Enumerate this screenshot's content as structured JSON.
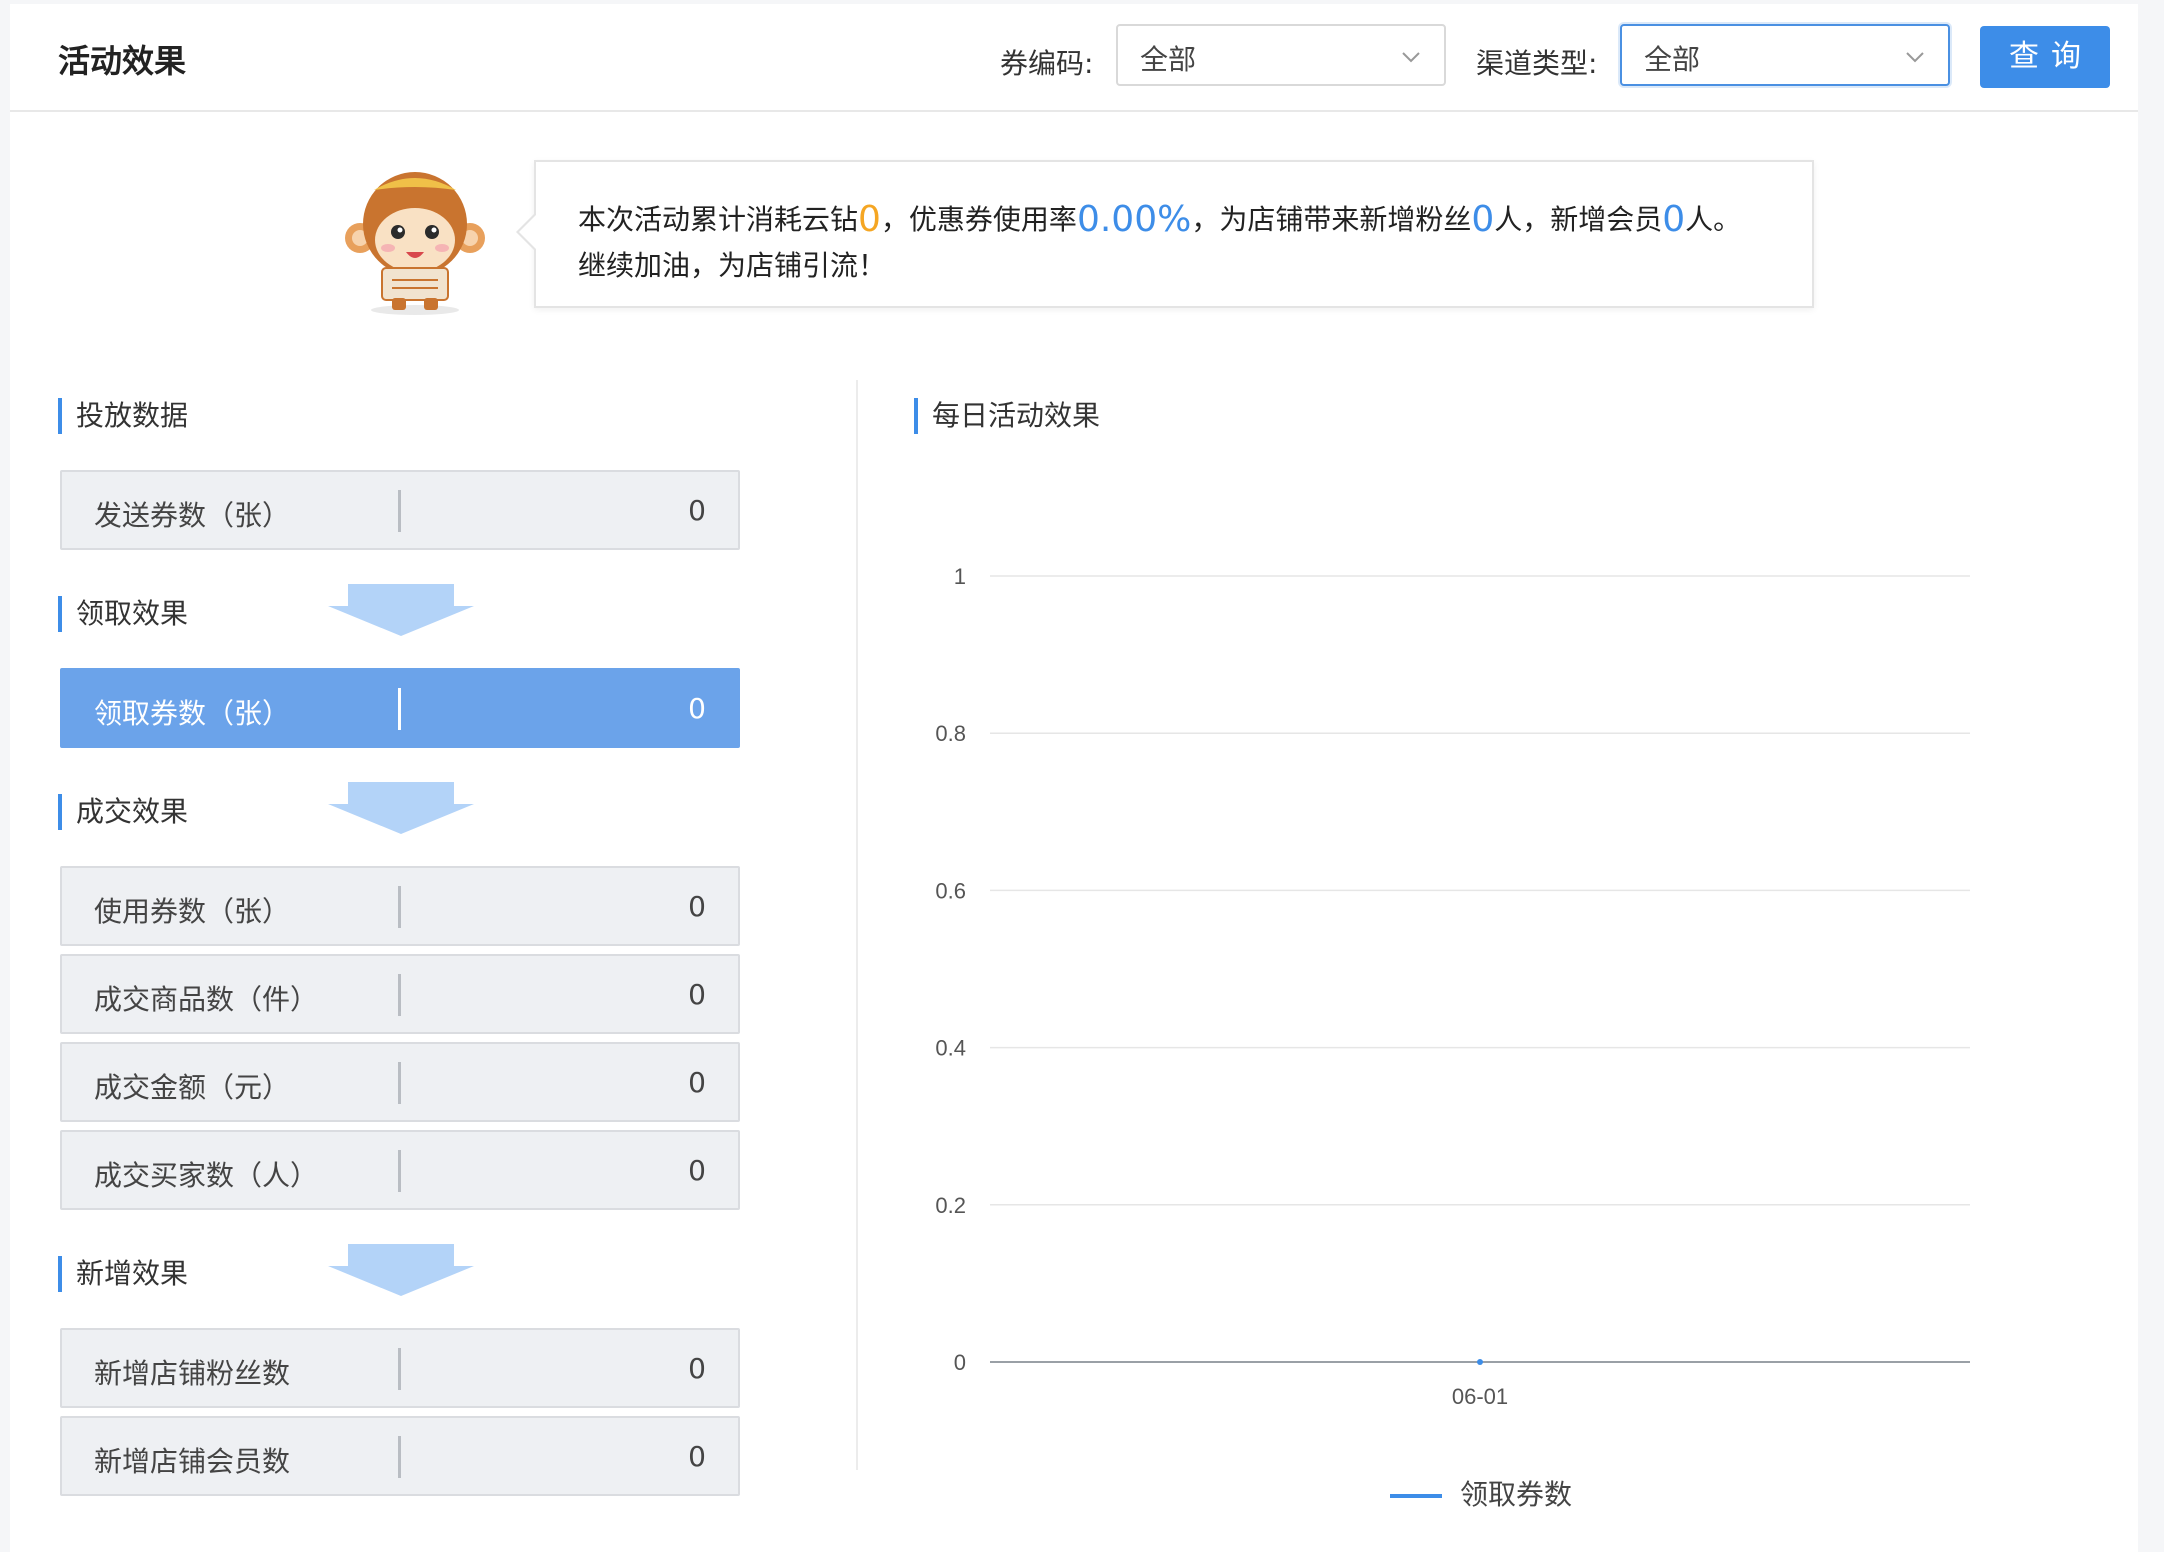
{
  "header": {
    "title": "活动效果",
    "coupon_code_label": "券编码:",
    "coupon_code_value": "全部",
    "channel_type_label": "渠道类型:",
    "channel_type_value": "全部",
    "query_button": "查询"
  },
  "summary": {
    "text_1": "本次活动累计消耗云钻",
    "cloud_diamonds": "0",
    "text_2": "，优惠券使用率",
    "usage_rate": "0.00%",
    "text_3": "，为店铺带来新增粉丝",
    "new_fans": "0",
    "text_4": "人，新增会员",
    "new_members": "0",
    "text_5": "人。",
    "line_2": "继续加油，为店铺引流！"
  },
  "sections": {
    "delivery": {
      "title": "投放数据",
      "items": [
        {
          "label": "发送券数（张）",
          "value": "0"
        }
      ]
    },
    "receive": {
      "title": "领取效果",
      "items": [
        {
          "label": "领取券数（张）",
          "value": "0"
        }
      ]
    },
    "deal": {
      "title": "成交效果",
      "items": [
        {
          "label": "使用券数（张）",
          "value": "0"
        },
        {
          "label": "成交商品数（件）",
          "value": "0"
        },
        {
          "label": "成交金额（元）",
          "value": "0"
        },
        {
          "label": "成交买家数（人）",
          "value": "0"
        }
      ]
    },
    "growth": {
      "title": "新增效果",
      "items": [
        {
          "label": "新增店铺粉丝数",
          "value": "0"
        },
        {
          "label": "新增店铺会员数",
          "value": "0"
        }
      ]
    }
  },
  "colors": {
    "accent": "#3d8de8",
    "highlight": "#6ba3ea",
    "orange": "#f5a623",
    "arrow": "#b3d3f8"
  },
  "icons": [
    "chevron-down-icon",
    "mascot-monkey-icon",
    "flow-arrow-down-icon"
  ],
  "chart_data": {
    "type": "line",
    "title": "每日活动效果",
    "categories": [
      "06-01"
    ],
    "series": [
      {
        "name": "领取券数",
        "values": [
          0
        ]
      }
    ],
    "ylim": [
      0,
      1
    ],
    "yticks": [
      "0",
      "0.2",
      "0.4",
      "0.6",
      "0.8",
      "1"
    ],
    "grid": true,
    "legend": "bottom"
  }
}
